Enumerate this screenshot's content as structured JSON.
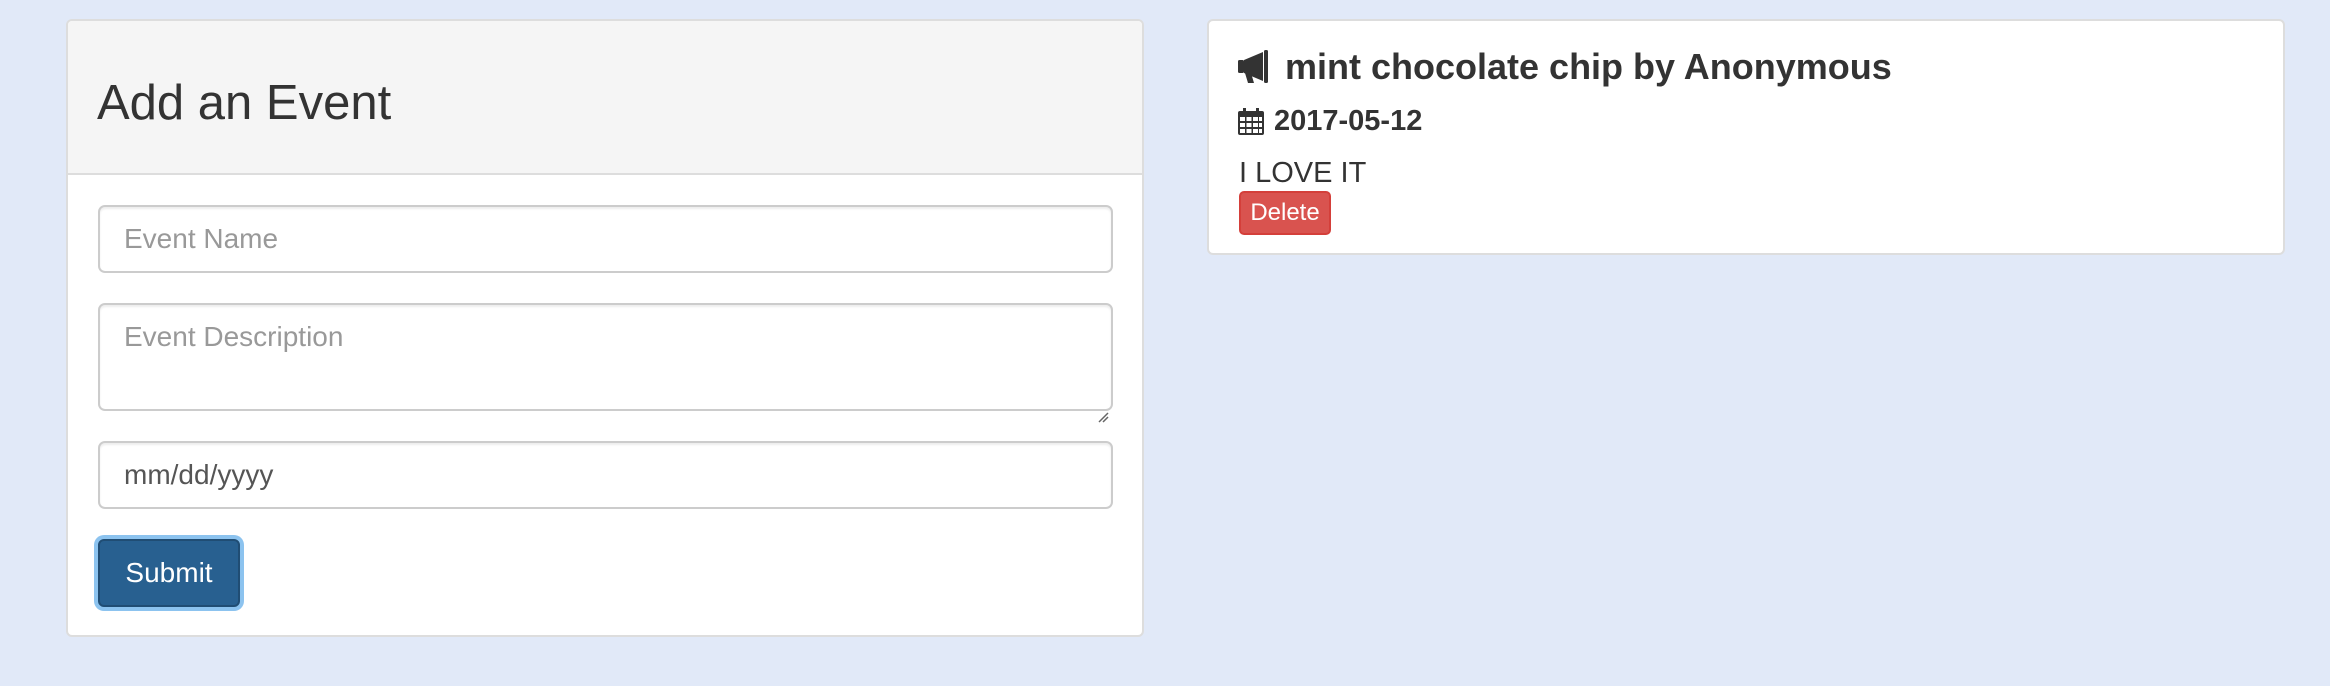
{
  "form_panel": {
    "title": "Add an Event",
    "event_name": {
      "placeholder": "Event Name",
      "value": ""
    },
    "event_description": {
      "placeholder": "Event Description",
      "value": ""
    },
    "event_date": {
      "display": "mm/dd/yyyy"
    },
    "submit_label": "Submit"
  },
  "event_card": {
    "title": "mint chocolate chip by Anonymous",
    "title_icon": "bullhorn-icon",
    "date": "2017-05-12",
    "date_icon": "calendar-icon",
    "description": "I LOVE IT",
    "delete_label": "Delete"
  },
  "colors": {
    "background": "#e1e9f8",
    "primary_button": "#286090",
    "danger_button": "#d9534f"
  }
}
